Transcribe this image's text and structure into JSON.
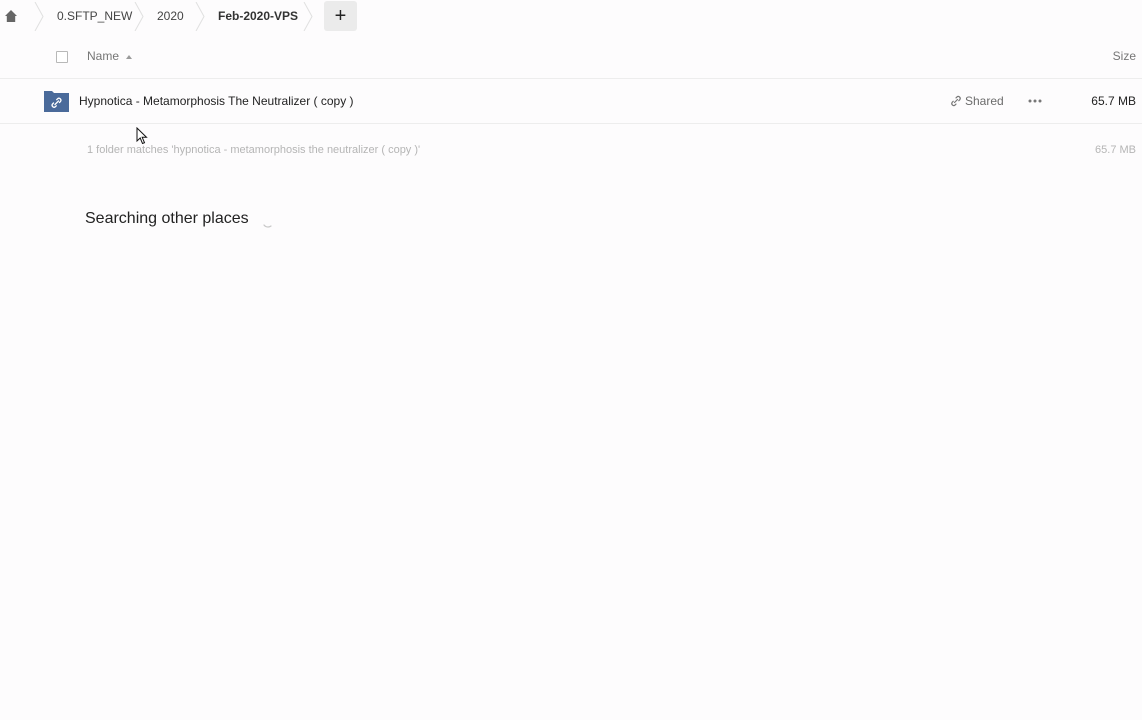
{
  "breadcrumb": {
    "home_icon": "home-icon",
    "items": [
      {
        "label": "0.SFTP_NEW"
      },
      {
        "label": "2020"
      },
      {
        "label": "Feb-2020-VPS"
      }
    ],
    "add_label": "+"
  },
  "table": {
    "columns": {
      "name": "Name",
      "size": "Size"
    },
    "rows": [
      {
        "name": "Hypnotica - Metamorphosis The Neutralizer ( copy )",
        "icon": "shared-link-folder-icon",
        "shared_label": "Shared",
        "size": "65.7 MB"
      }
    ],
    "summary": {
      "text": "1 folder matches 'hypnotica - metamorphosis the neutralizer ( copy )'",
      "size": "65.7 MB"
    }
  },
  "search": {
    "other_places": "Searching other places"
  },
  "colors": {
    "folder": "#4a6a9a",
    "background": "#fdfcfd",
    "muted_text": "#b5b5b5"
  }
}
